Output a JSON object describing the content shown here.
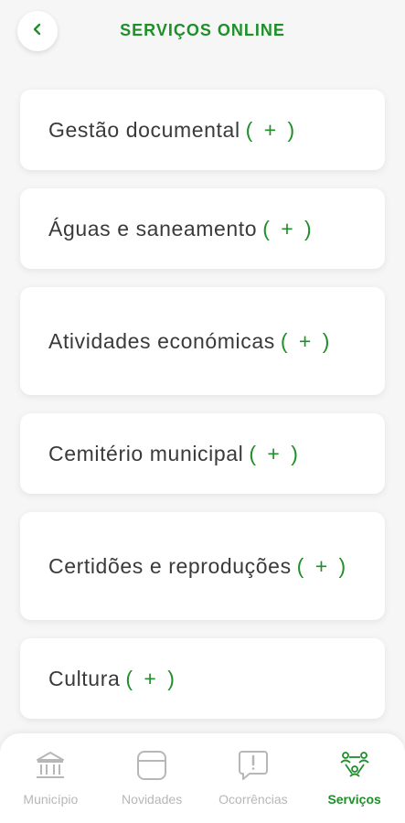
{
  "header": {
    "title": "SERVIÇOS ONLINE",
    "back_icon": "chevron-left-icon"
  },
  "services": [
    {
      "label": "Gestão documental",
      "plus": "( + )"
    },
    {
      "label": "Águas e saneamento",
      "plus": "( + )"
    },
    {
      "label": "Atividades económicas",
      "plus": "( + )"
    },
    {
      "label": "Cemitério municipal",
      "plus": "( + )"
    },
    {
      "label": "Certidões e reproduções",
      "plus": "( + )"
    },
    {
      "label": "Cultura",
      "plus": "( + )"
    }
  ],
  "bottom_nav": {
    "items": [
      {
        "label": "Município",
        "icon": "building-icon"
      },
      {
        "label": "Novidades",
        "icon": "news-icon"
      },
      {
        "label": "Ocorrências",
        "icon": "alert-icon"
      },
      {
        "label": "Serviços",
        "icon": "services-icon"
      }
    ],
    "active_index": 3
  },
  "colors": {
    "accent": "#1f8f2a",
    "inactive": "#b7b7b7",
    "text": "#3a3a3a"
  }
}
